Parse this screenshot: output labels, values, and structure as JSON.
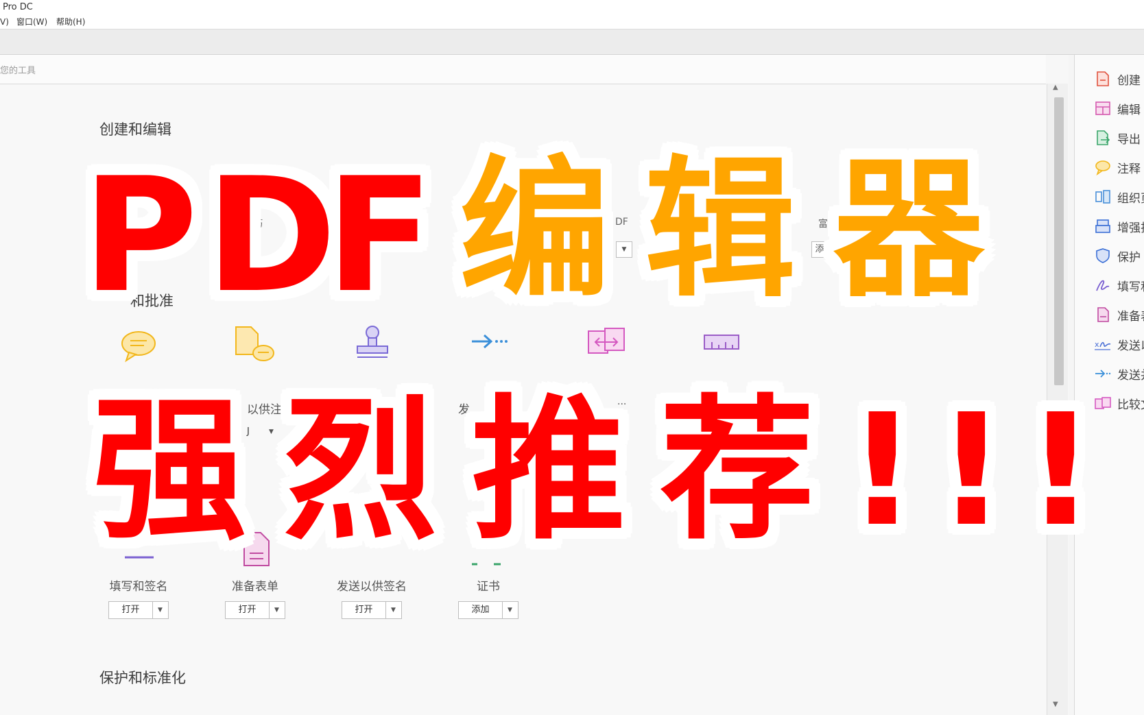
{
  "window": {
    "title": "Pro DC"
  },
  "menu": {
    "item_view": "V)",
    "item_window": "窗口(W)",
    "item_help": "帮助(H)"
  },
  "search": {
    "placeholder_text": "您的工具"
  },
  "sections": {
    "create_edit": "创建和编辑",
    "review_approve": "和批准",
    "protect_standardize": "保护和标准化"
  },
  "partial_labels": {
    "t1": "建",
    "t2": "巧",
    "t3": "DF",
    "t4": "富",
    "btn2": "]",
    "btn4": "添",
    "r2_2": "以供注",
    "r2_2btn": "J",
    "r2_4": "发",
    "r2_5": "..."
  },
  "tools_row3": [
    {
      "label": "填写和签名",
      "button": "打开"
    },
    {
      "label": "准备表单",
      "button": "打开"
    },
    {
      "label": "发送以供签名",
      "button": "打开"
    },
    {
      "label": "证书",
      "button": "添加"
    }
  ],
  "right_panel": [
    {
      "label": "创建 P",
      "icon": "create-pdf-icon",
      "color": "#e0513c"
    },
    {
      "label": "编辑 P",
      "icon": "edit-pdf-icon",
      "color": "#d45ab0"
    },
    {
      "label": "导出 P",
      "icon": "export-pdf-icon",
      "color": "#3aa56a"
    },
    {
      "label": "注释",
      "icon": "comment-icon",
      "color": "#f2b71c"
    },
    {
      "label": "组织页",
      "icon": "organize-pages-icon",
      "color": "#4a90d9"
    },
    {
      "label": "增强扫",
      "icon": "scan-icon",
      "color": "#3b6fd6"
    },
    {
      "label": "保护",
      "icon": "shield-icon",
      "color": "#3b6fd6"
    },
    {
      "label": "填写和",
      "icon": "fill-sign-icon",
      "color": "#7a5fd1"
    },
    {
      "label": "准备表",
      "icon": "prepare-form-icon",
      "color": "#c04aa0"
    },
    {
      "label": "发送以",
      "icon": "send-sign-icon",
      "color": "#4a6fd6"
    },
    {
      "label": "发送并",
      "icon": "send-track-icon",
      "color": "#3a8fd9"
    },
    {
      "label": "比较文",
      "icon": "compare-icon",
      "color": "#d458c0"
    }
  ],
  "overlay": {
    "line1_red": [
      "P",
      "D",
      "F"
    ],
    "line1_orange": [
      "编",
      "辑",
      "器"
    ],
    "line2": [
      "强",
      "烈",
      "推",
      "荐",
      "!",
      "!",
      "!"
    ]
  },
  "colors": {
    "overlay_red": "#ff0000",
    "overlay_orange": "#ffa500"
  }
}
